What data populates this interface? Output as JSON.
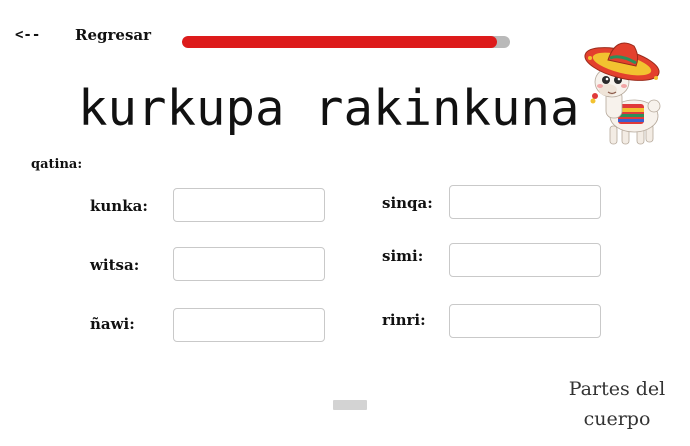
{
  "nav": {
    "back_arrow": "<--",
    "back_label": "Regresar"
  },
  "progress": {
    "value_percent": 96,
    "fill_color": "#dd1b1b",
    "track_color": "#b9b9b9"
  },
  "title": "kurkupa rakinkuna",
  "mascot": {
    "icon": "llama-with-sombrero-icon"
  },
  "section_label": "qatina:",
  "fields": {
    "kunka": {
      "label": "kunka:",
      "value": ""
    },
    "witsa": {
      "label": "witsa:",
      "value": ""
    },
    "nawi": {
      "label": "ñawi:",
      "value": ""
    },
    "sinqa": {
      "label": "sinqa:",
      "value": ""
    },
    "simi": {
      "label": "simi:",
      "value": ""
    },
    "rinri": {
      "label": "rinri:",
      "value": ""
    }
  },
  "caption": "Partes del cuerpo"
}
